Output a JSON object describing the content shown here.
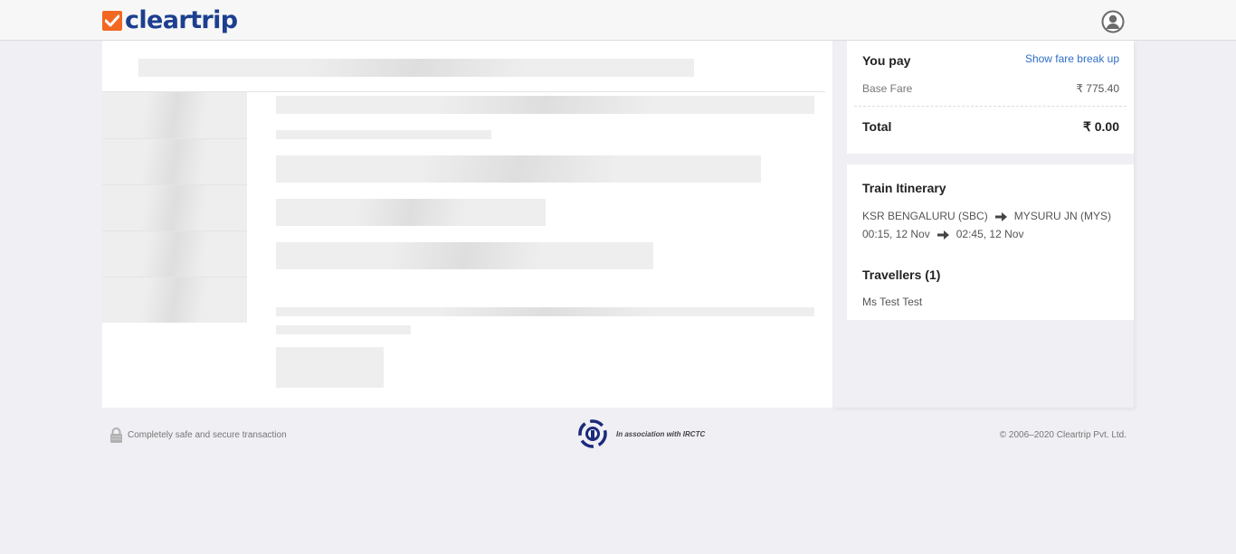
{
  "header": {
    "brand": "cleartrip",
    "logo_icon": "check-box-logo-icon",
    "user_icon": "user-account-icon",
    "accent_color": "#f26822",
    "brand_color": "#1d3f8f"
  },
  "fare": {
    "title": "You pay",
    "breakup_link": "Show fare break up",
    "base_fare_label": "Base Fare",
    "base_fare_value": "₹ 775.40",
    "total_label": "Total",
    "total_value": "₹ 0.00"
  },
  "itinerary": {
    "title": "Train Itinerary",
    "from_station": "KSR BENGALURU (SBC)",
    "to_station": "MYSURU JN (MYS)",
    "depart": "00:15, 12 Nov",
    "arrive": "02:45, 12 Nov",
    "arrow_icon": "right-arrow-icon"
  },
  "travellers": {
    "title": "Travellers (1)",
    "names": [
      "Ms Test Test"
    ]
  },
  "footer": {
    "secure_text": "Completely safe and secure transaction",
    "irctc_text": "In association with IRCTC",
    "copyright": "© 2006–2020 Cleartrip Pvt. Ltd."
  }
}
